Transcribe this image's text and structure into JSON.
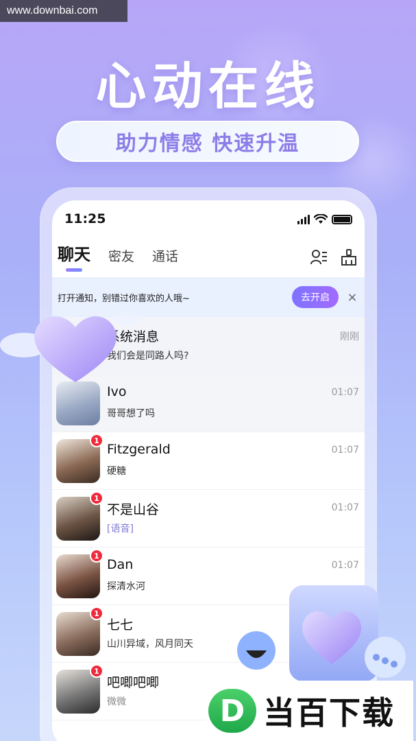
{
  "watermark": "www.downbai.com",
  "hero": {
    "title": "心动在线",
    "subtitle": "助力情感  快速升温"
  },
  "status_bar": {
    "time": "11:25"
  },
  "tabs": [
    {
      "label": "聊天",
      "active": true
    },
    {
      "label": "密友",
      "active": false
    },
    {
      "label": "通话",
      "active": false
    }
  ],
  "top_icons": [
    "contacts-icon",
    "cleanup-broom-icon"
  ],
  "notice": {
    "text": "打开通知，别错过你喜欢的人哦~",
    "button": "去开启",
    "close": "×"
  },
  "conversations": [
    {
      "name": "系统消息",
      "message": "我们会是同路人吗?",
      "time": "刚刚",
      "badge": ""
    },
    {
      "name": "Ivo",
      "message": "哥哥想了吗",
      "time": "01:07",
      "badge": ""
    },
    {
      "name": "Fitzgerald",
      "message": "硬糖",
      "time": "01:07",
      "badge": "1"
    },
    {
      "name": "不是山谷",
      "message": "[语音]",
      "time": "01:07",
      "badge": "1"
    },
    {
      "name": "Dan",
      "message": "探清水河",
      "time": "01:07",
      "badge": "1"
    },
    {
      "name": "七七",
      "message": "山川异域，风月同天",
      "time": "",
      "badge": "1"
    },
    {
      "name": "吧唧吧唧",
      "message": "微微",
      "time": "",
      "badge": "1"
    }
  ],
  "brand": {
    "logo_letter": "D",
    "text": "当百下载"
  },
  "colors": {
    "accent": "#8d7de8",
    "badge": "#f0293b",
    "notice_bg": "#e9f0fe",
    "button_gradient_start": "#7d73ff",
    "button_gradient_end": "#a36bff"
  }
}
